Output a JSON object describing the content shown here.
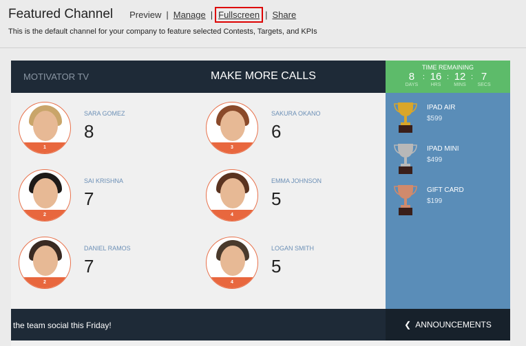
{
  "header": {
    "title": "Featured Channel",
    "links": [
      "Preview",
      "Manage",
      "Fullscreen",
      "Share"
    ],
    "separator": "|",
    "description": "This is the default channel for your company to feature selected Contests, Targets, and KPIs"
  },
  "channel": {
    "brand": "MOTIVATOR TV",
    "headline": "MAKE MORE CALLS"
  },
  "timer": {
    "label": "TIME REMAINING",
    "units": [
      {
        "value": "8",
        "label": "DAYS"
      },
      {
        "value": "16",
        "label": "HRS"
      },
      {
        "value": "12",
        "label": "MINS"
      },
      {
        "value": "7",
        "label": "SECS"
      }
    ],
    "separator": ":"
  },
  "prizes": [
    {
      "name": "IPAD AIR",
      "value": "$599",
      "color": "#d9a62a"
    },
    {
      "name": "IPAD MINI",
      "value": "$499",
      "color": "#b8b8b8"
    },
    {
      "name": "GIFT CARD",
      "value": "$199",
      "color": "#d08a6c"
    }
  ],
  "leaders": [
    {
      "name": "SARA GOMEZ",
      "score": "8",
      "rank": "1",
      "hair": "#c9a56a"
    },
    {
      "name": "SAKURA OKANO",
      "score": "6",
      "rank": "3",
      "hair": "#8a4a2a"
    },
    {
      "name": "SAI KRISHNA",
      "score": "7",
      "rank": "2",
      "hair": "#1e1a18"
    },
    {
      "name": "EMMA JOHNSON",
      "score": "5",
      "rank": "4",
      "hair": "#5a3320"
    },
    {
      "name": "DANIEL RAMOS",
      "score": "7",
      "rank": "2",
      "hair": "#3a2a22"
    },
    {
      "name": "LOGAN SMITH",
      "score": "5",
      "rank": "4",
      "hair": "#4a3a2c"
    }
  ],
  "footer": {
    "ticker": "the team social this Friday!",
    "announcements": "ANNOUNCEMENTS"
  }
}
